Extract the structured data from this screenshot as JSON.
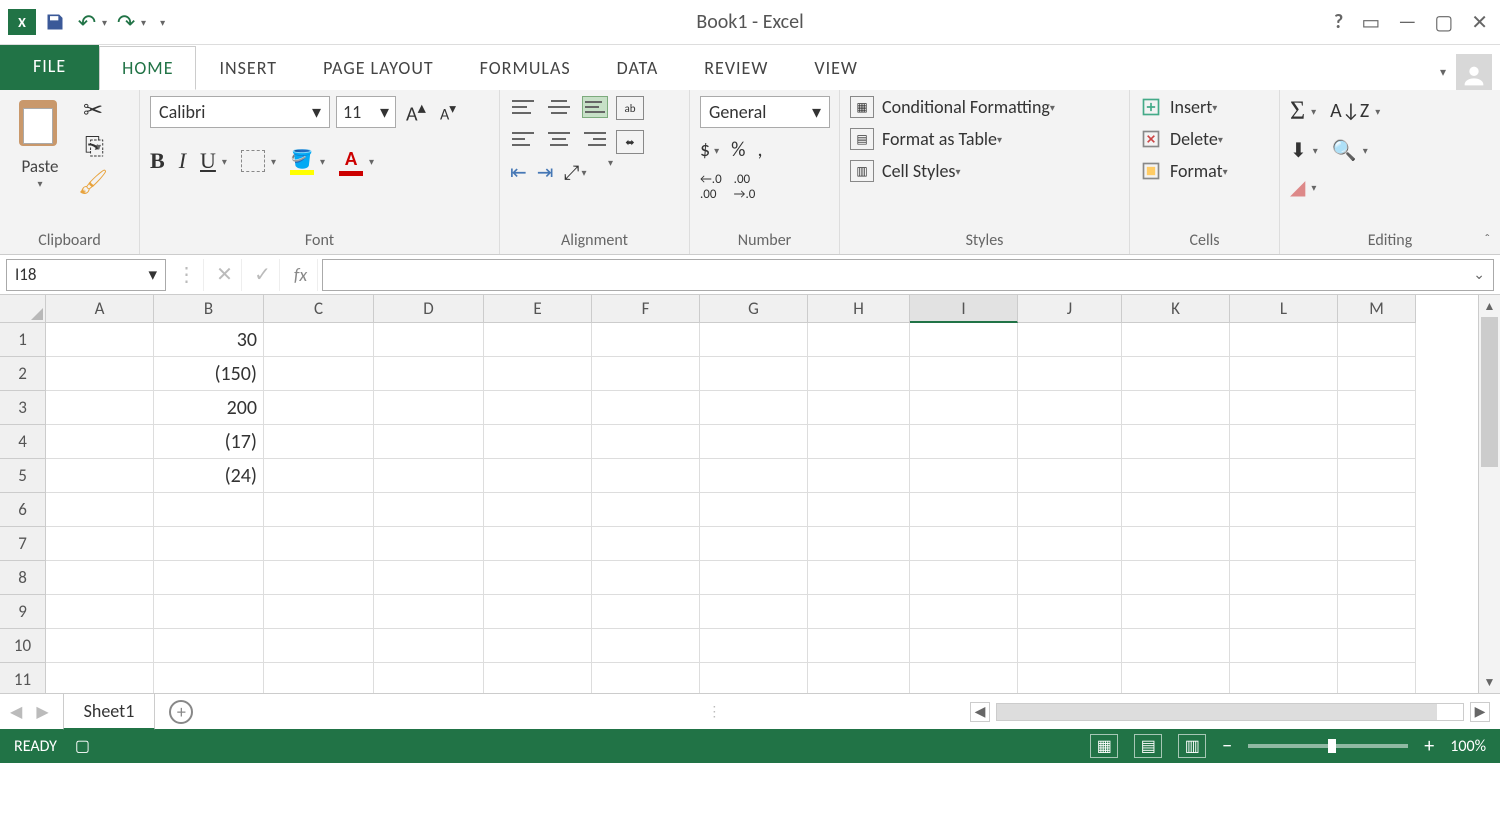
{
  "title": "Book1 - Excel",
  "tabs": {
    "file": "FILE",
    "home": "HOME",
    "insert": "INSERT",
    "page_layout": "PAGE LAYOUT",
    "formulas": "FORMULAS",
    "data": "DATA",
    "review": "REVIEW",
    "view": "VIEW"
  },
  "ribbon": {
    "clipboard": {
      "label": "Clipboard",
      "paste": "Paste"
    },
    "font": {
      "label": "Font",
      "name": "Calibri",
      "size": "11",
      "grow": "A",
      "shrink": "A",
      "b": "B",
      "i": "I",
      "u": "U",
      "color_a": "A"
    },
    "alignment": {
      "label": "Alignment"
    },
    "number": {
      "label": "Number",
      "format": "General",
      "currency": "$",
      "percent": "%",
      "comma": ",",
      "inc": ".0",
      "inc2": ".00",
      "dec": ".00",
      "dec2": ".0"
    },
    "styles": {
      "label": "Styles",
      "cond_fmt": "Conditional Formatting",
      "table": "Format as Table",
      "cell": "Cell Styles"
    },
    "cells": {
      "label": "Cells",
      "insert": "Insert",
      "delete": "Delete",
      "format": "Format"
    },
    "editing": {
      "label": "Editing",
      "sigma": "Σ"
    }
  },
  "formula_bar": {
    "name_box": "I18",
    "fx": "fx",
    "formula": ""
  },
  "columns": [
    "A",
    "B",
    "C",
    "D",
    "E",
    "F",
    "G",
    "H",
    "I",
    "J",
    "K",
    "L",
    "M"
  ],
  "active_column": "I",
  "rows": [
    "1",
    "2",
    "3",
    "4",
    "5",
    "6",
    "7",
    "8",
    "9",
    "10",
    "11"
  ],
  "cells": {
    "B1": "30",
    "B2": "(150)",
    "B3": "200",
    "B4": "(17)",
    "B5": "(24)"
  },
  "sheet_tabs": {
    "sheet1": "Sheet1"
  },
  "status": {
    "ready": "READY",
    "zoom": "100%"
  }
}
